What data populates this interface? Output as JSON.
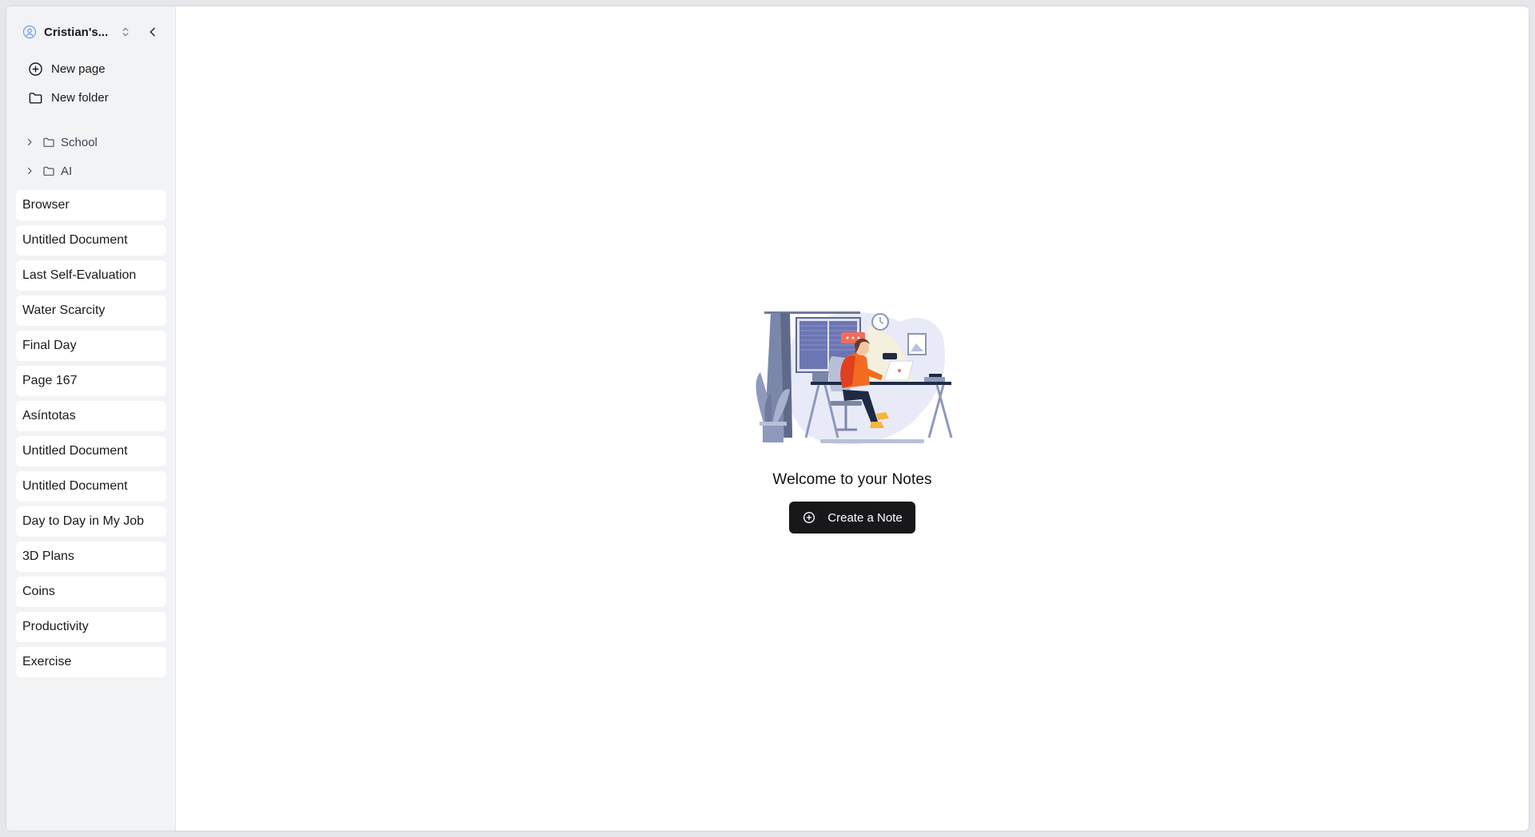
{
  "sidebar": {
    "workspace": {
      "name": "Cristian's...",
      "avatar_icon": "user-circle-icon",
      "switch_icon": "chevrons-up-down-icon",
      "collapse_icon": "chevron-left-icon"
    },
    "actions": [
      {
        "label": "New page",
        "icon": "plus-circle-icon"
      },
      {
        "label": "New folder",
        "icon": "folder-icon"
      }
    ],
    "folders": [
      {
        "label": "School",
        "icon": "folder-icon"
      },
      {
        "label": "AI",
        "icon": "folder-icon"
      }
    ],
    "pages": [
      "Browser",
      "Untitled Document",
      "Last Self-Evaluation",
      "Water Scarcity",
      "Final Day",
      "Page 167",
      "Asíntotas",
      "Untitled Document",
      "Untitled Document",
      "Day to Day in My Job",
      "3D Plans",
      "Coins",
      "Productivity",
      "Exercise"
    ]
  },
  "main": {
    "empty_state": {
      "illustration": "person-working-at-desk-illustration",
      "title": "Welcome to your Notes",
      "button_label": "Create a Note",
      "button_icon": "plus-circle-icon"
    }
  },
  "colors": {
    "sidebar_bg": "#f2f3f5",
    "button_bg": "#18181b",
    "accent_blue": "#5b8def"
  }
}
